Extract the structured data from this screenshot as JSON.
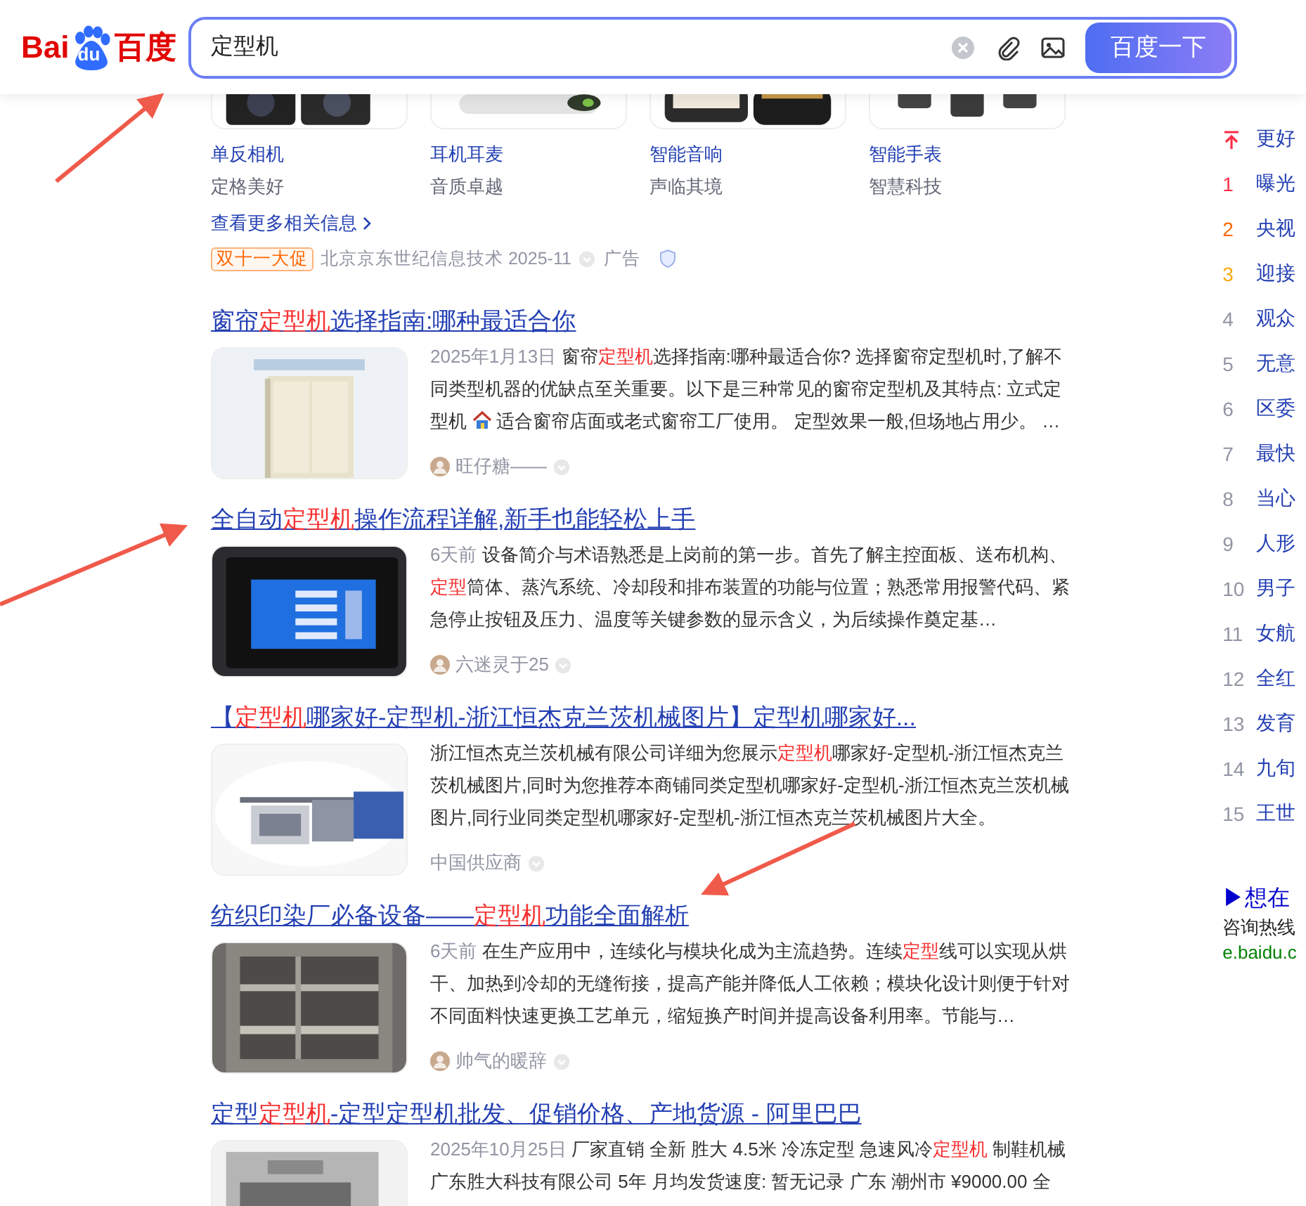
{
  "header": {
    "logo": [
      "Bai",
      "du",
      "百度"
    ],
    "search": {
      "value": "定型机",
      "button": "百度一下"
    }
  },
  "products": {
    "items": [
      {
        "name": "单反相机",
        "tagline": "定格美好"
      },
      {
        "name": "耳机耳麦",
        "tagline": "音质卓越"
      },
      {
        "name": "智能音响",
        "tagline": "声临其境"
      },
      {
        "name": "智能手表",
        "tagline": "智慧科技"
      }
    ],
    "more_link": "查看更多相关信息",
    "ad": {
      "tag": "双十一大促",
      "advertiser": "北京京东世纪信息技术 2025-11",
      "label": "广告"
    }
  },
  "results": [
    {
      "title": [
        {
          "text": "窗帘"
        },
        {
          "text": "定型机",
          "highlight": true
        },
        {
          "text": "选择指南:哪种最适合你"
        }
      ],
      "image": {
        "kind": "picture"
      },
      "date": "2025年1月13日",
      "snippet": [
        {
          "kind": "text",
          "text": "窗帘"
        },
        {
          "kind": "mark",
          "text": "定型机"
        },
        {
          "kind": "text",
          "text": "选择指南:哪种最适合你? 选择窗帘定型机时,了解不同类型机器的优缺点至关重要。以下是三种常见的窗帘定型机及其特点: 立式定型机 "
        },
        {
          "kind": "icon"
        },
        {
          "kind": "text",
          "text": " 适合窗帘店面或老式窗帘工厂使用。 定型效果一般,但场地占用少。 …"
        }
      ],
      "source": {
        "name": "旺仔糖——",
        "avatar": true
      }
    },
    {
      "title": [
        {
          "text": "全自动"
        },
        {
          "text": "定型机",
          "highlight": true
        },
        {
          "text": "操作流程详解,新手也能轻松上手"
        }
      ],
      "image": {
        "kind": "picture"
      },
      "date": "6天前",
      "snippet": [
        {
          "kind": "text",
          "text": "设备简介与术语熟悉是上岗前的第一步。首先了解主控面板、送布机构、"
        },
        {
          "kind": "mark",
          "text": "定型"
        },
        {
          "kind": "text",
          "text": "筒体、蒸汽系统、冷却段和排布装置的功能与位置；熟悉常用报警代码、紧急停止按钮及压力、温度等关键参数的显示含义，为后续操作奠定基…"
        }
      ],
      "source": {
        "name": "六迷灵于25",
        "avatar": true
      }
    },
    {
      "title": [
        {
          "text": "【"
        },
        {
          "text": "定型机",
          "highlight": true
        },
        {
          "text": "哪家好-定型机-浙江恒杰克兰茨机械图片】定型机哪家好..."
        }
      ],
      "image": {
        "kind": "picture"
      },
      "snippet": [
        {
          "kind": "text",
          "text": "浙江恒杰克兰茨机械有限公司详细为您展示"
        },
        {
          "kind": "mark",
          "text": "定型机"
        },
        {
          "kind": "text",
          "text": "哪家好-定型机-浙江恒杰克兰茨机械图片,同时为您推荐本商铺同类定型机哪家好-定型机-浙江恒杰克兰茨机械图片,同行业同类定型机哪家好-定型机-浙江恒杰克兰茨机械图片大全。"
        }
      ],
      "source": {
        "name": "中国供应商",
        "avatar": false
      }
    },
    {
      "title": [
        {
          "text": "纺织印染厂必备设备——"
        },
        {
          "text": "定型机",
          "highlight": true
        },
        {
          "text": "功能全面解析"
        }
      ],
      "image": {
        "kind": "picture"
      },
      "date": "6天前",
      "snippet": [
        {
          "kind": "text",
          "text": "在生产应用中，连续化与模块化成为主流趋势。连续"
        },
        {
          "kind": "mark",
          "text": "定型"
        },
        {
          "kind": "text",
          "text": "线可以实现从烘干、加热到冷却的无缝衔接，提高产能并降低人工依赖；模块化设计则便于针对不同面料快速更换工艺单元，缩短换产时间并提高设备利用率。节能与…"
        }
      ],
      "source": {
        "name": "帅气的暖辞",
        "avatar": true
      }
    },
    {
      "title": [
        {
          "text": "定型"
        },
        {
          "text": "定型机",
          "highlight": true
        },
        {
          "text": "-定型定型机批发、促销价格、产地货源 - 阿里巴巴"
        }
      ],
      "image": {
        "kind": "picture"
      },
      "date": "2025年10月25日",
      "snippet": [
        {
          "kind": "text",
          "text": "厂家直销 全新 胜大 4.5米 冷冻定型 急速风冷"
        },
        {
          "kind": "mark",
          "text": "定型机"
        },
        {
          "kind": "text",
          "text": " 制鞋机械广东胜大科技有限公司 5年 月均发货速度: 暂无记录 广东 潮州市 ¥9000.00 全"
        }
      ]
    }
  ],
  "hot_list": [
    {
      "kind": "pinned",
      "title": "更好",
      "color": "#fe2d46"
    },
    {
      "kind": "rank",
      "rank": "1",
      "title": "曝光",
      "color": "#fe2d46"
    },
    {
      "kind": "rank",
      "rank": "2",
      "title": "央视",
      "color": "#ff6600"
    },
    {
      "kind": "rank",
      "rank": "3",
      "title": "迎接",
      "color": "#faa90e"
    },
    {
      "kind": "rank",
      "rank": "4",
      "title": "观众",
      "color": "#9195a3"
    },
    {
      "kind": "rank",
      "rank": "5",
      "title": "无意",
      "color": "#9195a3"
    },
    {
      "kind": "rank",
      "rank": "6",
      "title": "区委",
      "color": "#9195a3"
    },
    {
      "kind": "rank",
      "rank": "7",
      "title": "最快",
      "color": "#9195a3"
    },
    {
      "kind": "rank",
      "rank": "8",
      "title": "当心",
      "color": "#9195a3"
    },
    {
      "kind": "rank",
      "rank": "9",
      "title": "人形",
      "color": "#9195a3"
    },
    {
      "kind": "rank",
      "rank": "10",
      "title": "男子",
      "color": "#9195a3"
    },
    {
      "kind": "rank",
      "rank": "11",
      "title": "女航",
      "color": "#9195a3"
    },
    {
      "kind": "rank",
      "rank": "12",
      "title": "全红",
      "color": "#9195a3"
    },
    {
      "kind": "rank",
      "rank": "13",
      "title": "发育",
      "color": "#9195a3"
    },
    {
      "kind": "rank",
      "rank": "14",
      "title": "九旬",
      "color": "#9195a3"
    },
    {
      "kind": "rank",
      "rank": "15",
      "title": "王世",
      "color": "#9195a3"
    }
  ],
  "side_ad": {
    "title": "▶想在",
    "text": "咨询热线",
    "url": "e.baidu.c"
  }
}
